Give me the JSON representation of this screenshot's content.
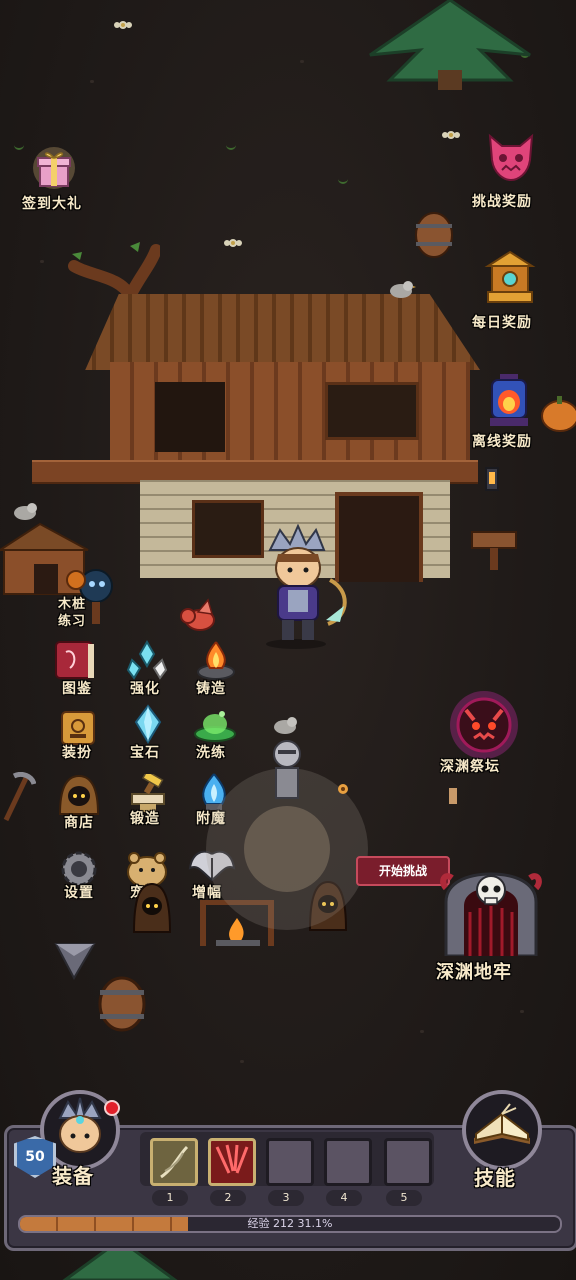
{
  "top_left": {
    "gift_label": "签到大礼"
  },
  "right_rewards": [
    {
      "label": "挑战奖励",
      "icon": "demon-mask-icon"
    },
    {
      "label": "每日奖励",
      "icon": "treasure-shrine-icon"
    },
    {
      "label": "离线奖励",
      "icon": "lantern-icon"
    }
  ],
  "features": {
    "training": "木桩\n练习",
    "grid": [
      {
        "label": "图鉴",
        "icon": "book-icon"
      },
      {
        "label": "强化",
        "icon": "crystal-wings-icon"
      },
      {
        "label": "铸造",
        "icon": "forge-fire-icon"
      },
      {
        "label": "装扮",
        "icon": "costume-scroll-icon"
      },
      {
        "label": "宝石",
        "icon": "gem-icon"
      },
      {
        "label": "洗练",
        "icon": "green-potion-icon"
      },
      {
        "label": "商店",
        "icon": "hooded-merchant-icon"
      },
      {
        "label": "锻造",
        "icon": "anvil-hammer-icon"
      },
      {
        "label": "附魔",
        "icon": "blue-flame-icon"
      },
      {
        "label": "设置",
        "icon": "gear-icon"
      },
      {
        "label": "宠物",
        "icon": "hamster-pet-icon"
      },
      {
        "label": "增幅",
        "icon": "dark-wings-icon"
      }
    ]
  },
  "abyss": {
    "altar_label": "深渊祭坛",
    "challenge_button": "开始挑战",
    "dungeon_label": "深渊地牢"
  },
  "bottom_bar": {
    "level": "50",
    "equip_label": "装备",
    "skill_label": "技能",
    "slots": [
      "1",
      "2",
      "3",
      "4",
      "5"
    ],
    "xp_text": "经验 212 31.1%",
    "xp_fraction": 0.311
  }
}
